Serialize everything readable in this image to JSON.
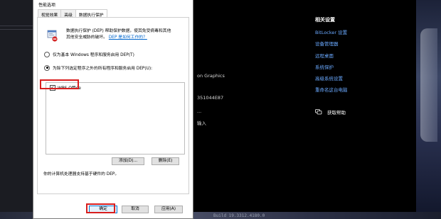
{
  "dialog": {
    "title": "性能选项",
    "tabs": [
      "视觉效果",
      "高级",
      "数据执行保护"
    ],
    "description_line1": "数据执行保护 (DEP) 帮助保护数据，使其免受病毒和其他",
    "description_line2": "其他安全威胁的破坏。",
    "description_link": "DEP 是如何工作的？",
    "radio_option1": "仅为基本 Windows 程序和服务启用 DEP(T)",
    "radio_option2": "为除下列选定程序之外的所有程序和服务启用 DEP(U):",
    "list_items": [
      {
        "label": "WPS Office",
        "checked": true
      }
    ],
    "add_button": "添加(D)...",
    "remove_button": "删除(E)",
    "note": "你的计算机处理器支持基于硬件的 DEP。",
    "ok_button": "确定",
    "cancel_button": "取消",
    "apply_button": "应用(A)"
  },
  "settings": {
    "related_title": "相关设置",
    "related_links": [
      "BitLocker 设置",
      "设备管理器",
      "远程桌面",
      "系统保护",
      "高级系统设置",
      "重命名这台电脑"
    ],
    "help_label": "获取帮助",
    "fragment_graphics": "on Graphics",
    "fragment_id": "351044E87",
    "fragment_dots": "...",
    "fragment_input": "输入",
    "build_text": "Build 19.3312.4180.0"
  },
  "colors": {
    "accent_blue": "#0078d7",
    "link_blue": "#6aa9ff",
    "highlight_red": "#d81e1e"
  }
}
